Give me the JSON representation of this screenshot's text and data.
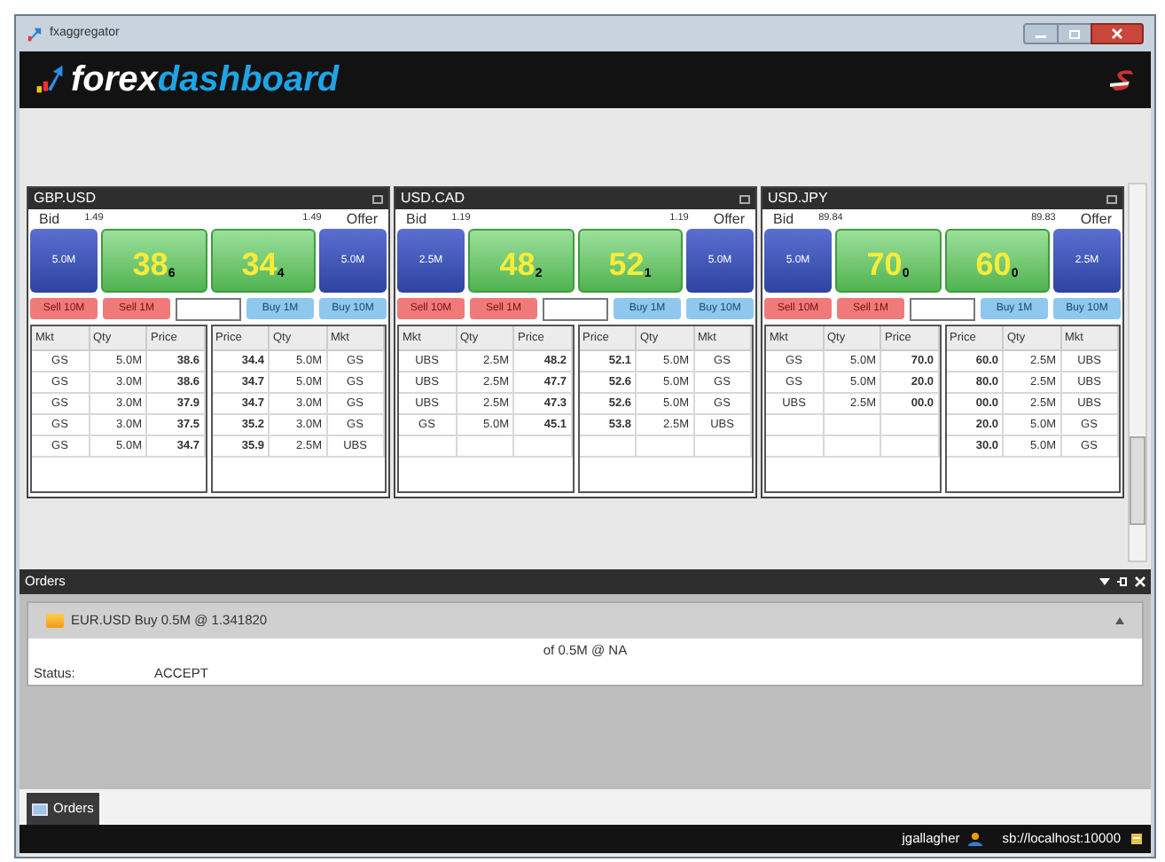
{
  "window": {
    "title": "fxaggregator"
  },
  "header": {
    "brand_main": "forex",
    "brand_accent": "dashboard"
  },
  "tiles": [
    {
      "pair": "GBP.USD",
      "bid_label": "Bid",
      "offer_label": "Offer",
      "bid_big_figure": "1.49",
      "offer_big_figure": "1.49",
      "bid_qty": "5.0M",
      "offer_qty": "5.0M",
      "bid_pips": "38",
      "bid_fraction": "6",
      "offer_pips": "34",
      "offer_fraction": "4",
      "buttons": [
        {
          "label": "Sell 10M",
          "kind": "sell"
        },
        {
          "label": "Sell 1M",
          "kind": "sell"
        },
        {
          "label": "Buy 1M",
          "kind": "buy"
        },
        {
          "label": "Buy 10M",
          "kind": "buy"
        }
      ],
      "bid_columns": [
        "Mkt",
        "Qty",
        "Price"
      ],
      "offer_columns": [
        "Price",
        "Qty",
        "Mkt"
      ],
      "bid_rows": [
        [
          "GS",
          "5.0M",
          "38.6"
        ],
        [
          "GS",
          "3.0M",
          "38.6"
        ],
        [
          "GS",
          "3.0M",
          "37.9"
        ],
        [
          "GS",
          "3.0M",
          "37.5"
        ],
        [
          "GS",
          "5.0M",
          "34.7"
        ]
      ],
      "offer_rows": [
        [
          "34.4",
          "5.0M",
          "GS"
        ],
        [
          "34.7",
          "5.0M",
          "GS"
        ],
        [
          "34.7",
          "3.0M",
          "GS"
        ],
        [
          "35.2",
          "3.0M",
          "GS"
        ],
        [
          "35.9",
          "2.5M",
          "UBS"
        ]
      ]
    },
    {
      "pair": "USD.CAD",
      "bid_label": "Bid",
      "offer_label": "Offer",
      "bid_big_figure": "1.19",
      "offer_big_figure": "1.19",
      "bid_qty": "2.5M",
      "offer_qty": "5.0M",
      "bid_pips": "48",
      "bid_fraction": "2",
      "offer_pips": "52",
      "offer_fraction": "1",
      "buttons": [
        {
          "label": "Sell 10M",
          "kind": "sell"
        },
        {
          "label": "Sell 1M",
          "kind": "sell"
        },
        {
          "label": "Buy 1M",
          "kind": "buy"
        },
        {
          "label": "Buy 10M",
          "kind": "buy"
        }
      ],
      "bid_columns": [
        "Mkt",
        "Qty",
        "Price"
      ],
      "offer_columns": [
        "Price",
        "Qty",
        "Mkt"
      ],
      "bid_rows": [
        [
          "UBS",
          "2.5M",
          "48.2"
        ],
        [
          "UBS",
          "2.5M",
          "47.7"
        ],
        [
          "UBS",
          "2.5M",
          "47.3"
        ],
        [
          "GS",
          "5.0M",
          "45.1"
        ]
      ],
      "offer_rows": [
        [
          "52.1",
          "5.0M",
          "GS"
        ],
        [
          "52.6",
          "5.0M",
          "GS"
        ],
        [
          "52.6",
          "5.0M",
          "GS"
        ],
        [
          "53.8",
          "2.5M",
          "UBS"
        ]
      ]
    },
    {
      "pair": "USD.JPY",
      "bid_label": "Bid",
      "offer_label": "Offer",
      "bid_big_figure": "89.84",
      "offer_big_figure": "89.83",
      "bid_qty": "5.0M",
      "offer_qty": "2.5M",
      "bid_pips": "70",
      "bid_fraction": "0",
      "offer_pips": "60",
      "offer_fraction": "0",
      "buttons": [
        {
          "label": "Sell 10M",
          "kind": "sell"
        },
        {
          "label": "Sell 1M",
          "kind": "sell"
        },
        {
          "label": "Buy 1M",
          "kind": "buy"
        },
        {
          "label": "Buy 10M",
          "kind": "buy"
        }
      ],
      "bid_columns": [
        "Mkt",
        "Qty",
        "Price"
      ],
      "offer_columns": [
        "Price",
        "Qty",
        "Mkt"
      ],
      "bid_rows": [
        [
          "GS",
          "5.0M",
          "70.0"
        ],
        [
          "GS",
          "5.0M",
          "20.0"
        ],
        [
          "UBS",
          "2.5M",
          "00.0"
        ]
      ],
      "offer_rows": [
        [
          "60.0",
          "2.5M",
          "UBS"
        ],
        [
          "80.0",
          "2.5M",
          "UBS"
        ],
        [
          "00.0",
          "2.5M",
          "UBS"
        ],
        [
          "20.0",
          "5.0M",
          "GS"
        ],
        [
          "30.0",
          "5.0M",
          "GS"
        ]
      ]
    }
  ],
  "orders": {
    "title": "Orders",
    "items": [
      {
        "summary": "EUR.USD Buy 0.5M @ 1.341820",
        "fill": "of 0.5M @ NA",
        "status_label": "Status:",
        "status": "ACCEPT"
      }
    ]
  },
  "bottom_tabs": [
    {
      "label": "Orders",
      "selected": true
    }
  ],
  "status_bar": {
    "user": "jgallagher",
    "server": "sb://localhost:10000"
  }
}
